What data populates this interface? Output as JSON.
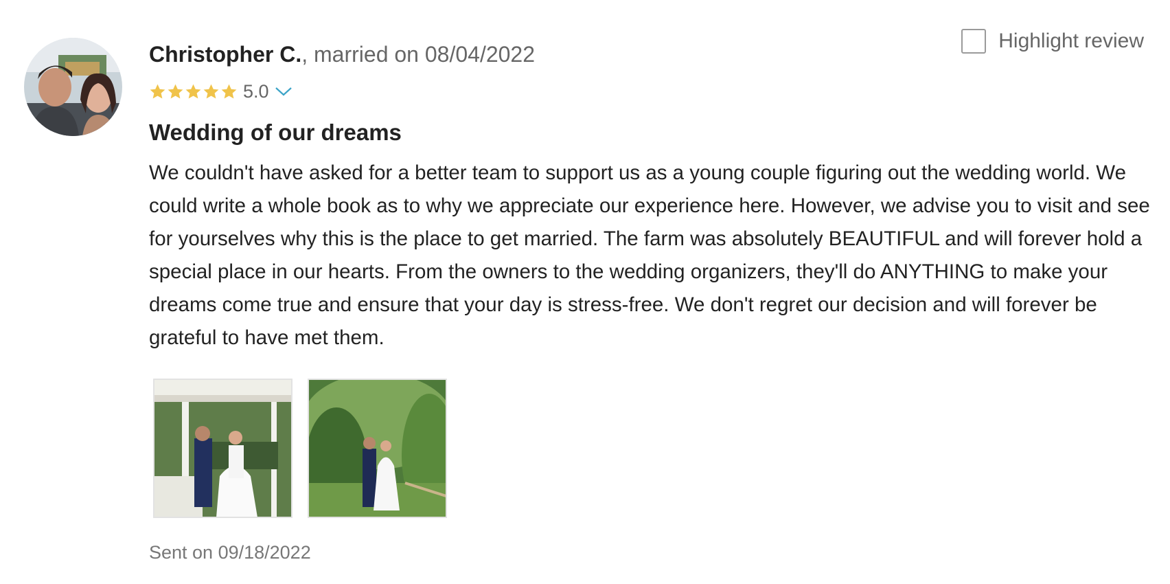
{
  "review": {
    "author_name": "Christopher C.",
    "married_text": ", married on 08/04/2022",
    "rating": "5.0",
    "stars": 5,
    "title": "Wedding of our dreams",
    "body": "We couldn't have asked for a better team to support us as a young couple figuring out the wedding world. We could write a whole book as to why we appreciate our experience here. However, we advise you to visit and see for yourselves why this is the place to get married. The farm was absolutely BEAUTIFUL and will forever hold a special place in our hearts. From the owners to the wedding organizers, they'll do ANYTHING to make your dreams come true and ensure that your day is stress-free. We don't regret our decision and will forever be grateful to have met them.",
    "sent_text": "Sent on 09/18/2022",
    "photos": [
      {
        "name": "gazebo-wedding-photo"
      },
      {
        "name": "garden-wedding-photo"
      }
    ]
  },
  "highlight": {
    "label": "Highlight review",
    "checked": false
  },
  "colors": {
    "star": "#f0c34a",
    "chevron": "#3ba3c7",
    "text": "#222222",
    "muted": "#666666"
  },
  "icons": [
    "star-icon",
    "chevron-down-icon",
    "checkbox-icon"
  ]
}
